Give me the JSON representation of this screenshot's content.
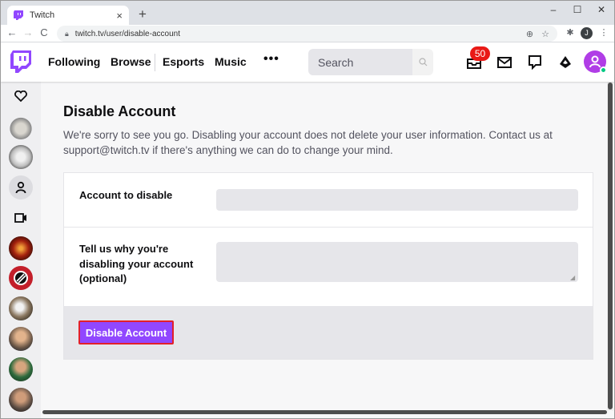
{
  "browser": {
    "tab_title": "Twitch",
    "tab_close": "×",
    "new_tab": "+",
    "minimize": "–",
    "maximize": "☐",
    "close": "✕",
    "url": "twitch.tv/user/disable-account",
    "profile_initial": "J"
  },
  "topnav": {
    "links": [
      "Following",
      "Browse",
      "Esports",
      "Music"
    ],
    "more": "•••",
    "search_placeholder": "Search",
    "notification_count": "50"
  },
  "page": {
    "title": "Disable Account",
    "description": "We're sorry to see you go. Disabling your account does not delete your user information. Contact us at support@twitch.tv if there's anything we can do to change your mind.",
    "field_account_label": "Account to disable",
    "field_reason_label_lines": [
      "Tell us why you're",
      "disabling your account",
      "(optional)"
    ],
    "disable_button": "Disable Account"
  },
  "colors": {
    "brand": "#9147ff",
    "badge": "#e91916",
    "highlight_border": "#e3202a"
  },
  "sidebar_icons": [
    "heart-icon",
    "camera-icon"
  ]
}
